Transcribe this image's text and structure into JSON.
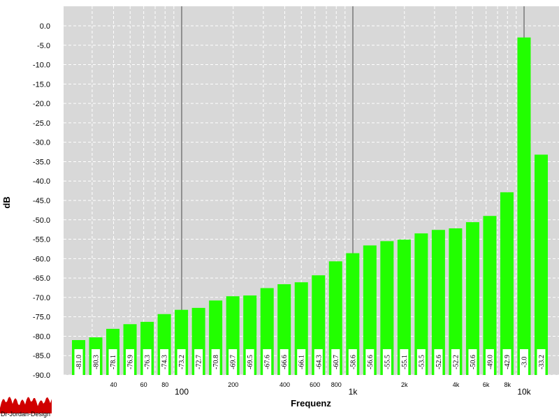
{
  "chart_data": {
    "type": "bar",
    "xlabel": "Frequenz",
    "ylabel": "dB",
    "ylim": [
      -90,
      0
    ],
    "yticks": [
      "0.0",
      "-5.0",
      "-10.0",
      "-15.0",
      "-20.0",
      "-25.0",
      "-30.0",
      "-35.0",
      "-40.0",
      "-45.0",
      "-50.0",
      "-55.0",
      "-60.0",
      "-65.0",
      "-70.0",
      "-75.0",
      "-80.0",
      "-85.0",
      "-90.0"
    ],
    "x_scale": "log",
    "x_major_ticks": [
      {
        "value": 100,
        "label": "100"
      },
      {
        "value": 1000,
        "label": "1k"
      },
      {
        "value": 10000,
        "label": "10k"
      }
    ],
    "x_minor_ticks": [
      {
        "value": 40,
        "label": "40"
      },
      {
        "value": 60,
        "label": "60"
      },
      {
        "value": 80,
        "label": "80"
      },
      {
        "value": 200,
        "label": "200"
      },
      {
        "value": 400,
        "label": "400"
      },
      {
        "value": 600,
        "label": "600"
      },
      {
        "value": 800,
        "label": "800"
      },
      {
        "value": 2000,
        "label": "2k"
      },
      {
        "value": 4000,
        "label": "4k"
      },
      {
        "value": 6000,
        "label": "6k"
      },
      {
        "value": 8000,
        "label": "8k"
      }
    ],
    "categories": [
      "25",
      "31.5",
      "40",
      "50",
      "63",
      "80",
      "100",
      "125",
      "160",
      "200",
      "250",
      "315",
      "400",
      "500",
      "630",
      "800",
      "1k",
      "1.25k",
      "1.6k",
      "2k",
      "2.5k",
      "3.15k",
      "4k",
      "5k",
      "6.3k",
      "8k",
      "10k",
      "12.5k"
    ],
    "values": [
      -81.0,
      -80.3,
      -78.1,
      -76.9,
      -76.3,
      -74.3,
      -73.2,
      -72.7,
      -70.8,
      -69.7,
      -69.5,
      -67.6,
      -66.6,
      -66.1,
      -64.3,
      -60.7,
      -58.6,
      -56.6,
      -55.5,
      -55.1,
      -53.5,
      -52.6,
      -52.2,
      -50.6,
      -49.0,
      -42.9,
      -3.0,
      -33.2
    ],
    "value_labels": [
      "-81.0",
      "-80.3",
      "-78.1",
      "-76.9",
      "-76.3",
      "-74.3",
      "-73.2",
      "-72.7",
      "-70.8",
      "-69.7",
      "-69.5",
      "-67.6",
      "-66.6",
      "-66.1",
      "-64.3",
      "-60.7",
      "-58.6",
      "-56.6",
      "-55.5",
      "-55.1",
      "-53.5",
      "-52.6",
      "-52.2",
      "-50.6",
      "-49.0",
      "-42.9",
      "-3.0",
      "-33.2"
    ],
    "grid": true
  },
  "colors": {
    "bar": "#22ff00",
    "plot_background": "#d8d8d8",
    "grid": "#ffffff",
    "major_line": "#909090",
    "page_background": "#ffffff"
  },
  "logo": {
    "text": "Dr-Jordan-Design",
    "colors": [
      "#d00000",
      "#ffffff"
    ]
  }
}
